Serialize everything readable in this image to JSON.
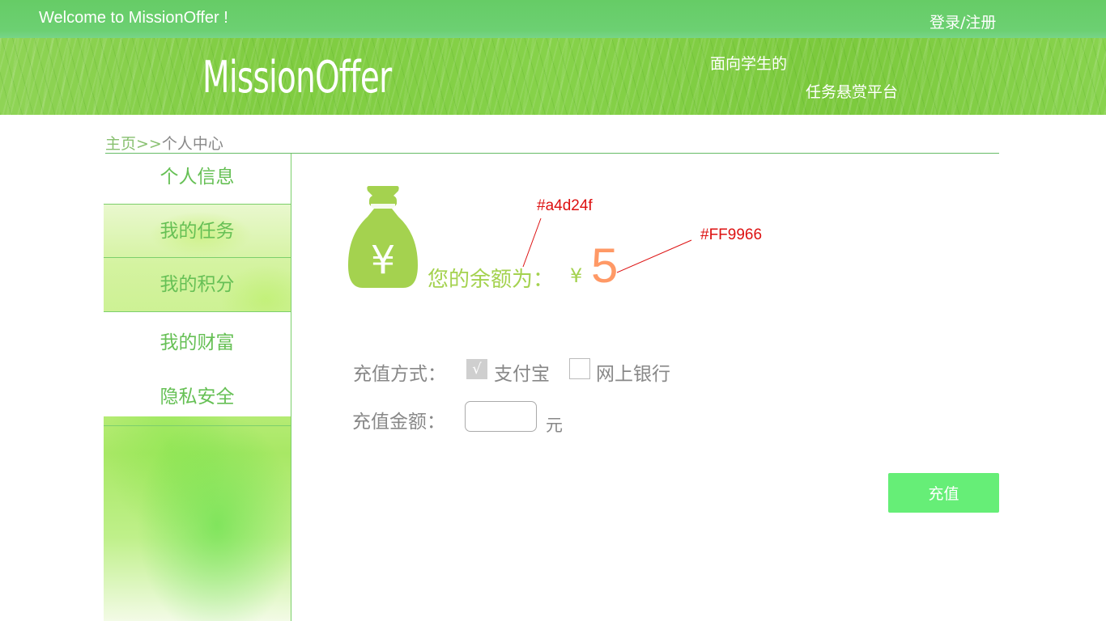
{
  "topbar": {
    "welcome": "Welcome to MissionOffer !",
    "login_register": "登录/注册"
  },
  "banner": {
    "logo": "MissionOffer",
    "slogan_line1": "面向学生的",
    "slogan_line2": "任务悬赏平台"
  },
  "breadcrumb": {
    "home": "主页",
    "separator": ">>",
    "current": "个人中心"
  },
  "sidebar": {
    "items": [
      {
        "label": "个人信息"
      },
      {
        "label": "我的任务"
      },
      {
        "label": "我的积分"
      },
      {
        "label": "我的财富"
      },
      {
        "label": "隐私安全"
      }
    ],
    "active_index": 3
  },
  "wealth": {
    "bag_icon": "money-bag-yen-icon",
    "bag_symbol": "¥",
    "balance_label": "您的余额为：",
    "currency": "¥",
    "balance_value": "5",
    "annotation_label_color": "#a4d24f",
    "annotation_value_color": "#FF9966"
  },
  "recharge": {
    "method_label": "充值方式：",
    "alipay_check": "√",
    "alipay_label": "支付宝",
    "alipay_checked": true,
    "bank_label": "网上银行",
    "bank_checked": false,
    "amount_label": "充值金额：",
    "amount_value": "",
    "unit": "元",
    "submit_label": "充值"
  },
  "colors": {
    "topbar": "#66cc66",
    "accent_green": "#a4d24f",
    "balance_orange": "#FF9966",
    "button_green": "#66ee77"
  }
}
